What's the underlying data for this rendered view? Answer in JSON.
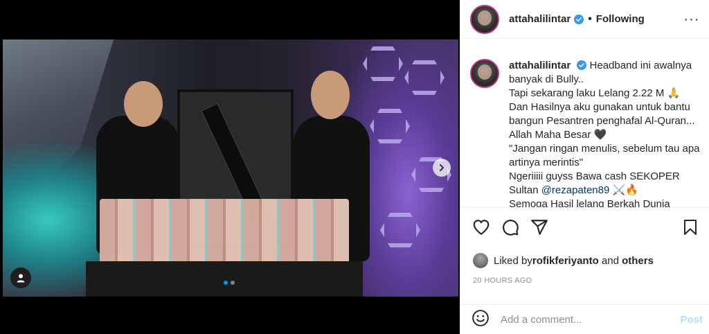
{
  "post": {
    "username": "attahalilintar",
    "follow_status": "Following",
    "separator": "•",
    "more_label": "···",
    "caption": {
      "username": "attahalilintar",
      "lines": [
        "Headband ini awalnya",
        "banyak di Bully..",
        "Tapi sekarang laku Lelang 2.22 M 🙏",
        "Dan Hasilnya aku gunakan untuk bantu",
        "bangun Pesantren penghafal Al-Quran...",
        "Allah Maha Besar 🖤",
        "\"Jangan ringan menulis, sebelum tau apa",
        "artinya merintis\"",
        "Ngeriiiii guyss Bawa cash SEKOPER",
        "Semoga Hasil lelang Berkah Dunia"
      ],
      "sultan_prefix": "Sultan ",
      "mention": "@rezapaten89",
      "mention_suffix": " ⚔️🔥"
    },
    "liked_by_prefix": "Liked by ",
    "liked_by_user": "rofikferiyanto",
    "liked_by_and": " and ",
    "liked_by_others": "others",
    "timestamp": "20 HOURS AGO",
    "comment_placeholder": "Add a comment...",
    "post_button": "Post",
    "carousel": {
      "total": 2,
      "current": 1
    }
  },
  "colors": {
    "accent": "#0095f6",
    "verified": "#3897f0",
    "link": "#00376b",
    "post_disabled": "#b2dffc"
  },
  "icons": [
    "more-icon",
    "verified-icon",
    "heart-icon",
    "comment-icon",
    "share-icon",
    "save-icon",
    "emoji-icon",
    "next-arrow-icon",
    "user-tag-icon"
  ]
}
